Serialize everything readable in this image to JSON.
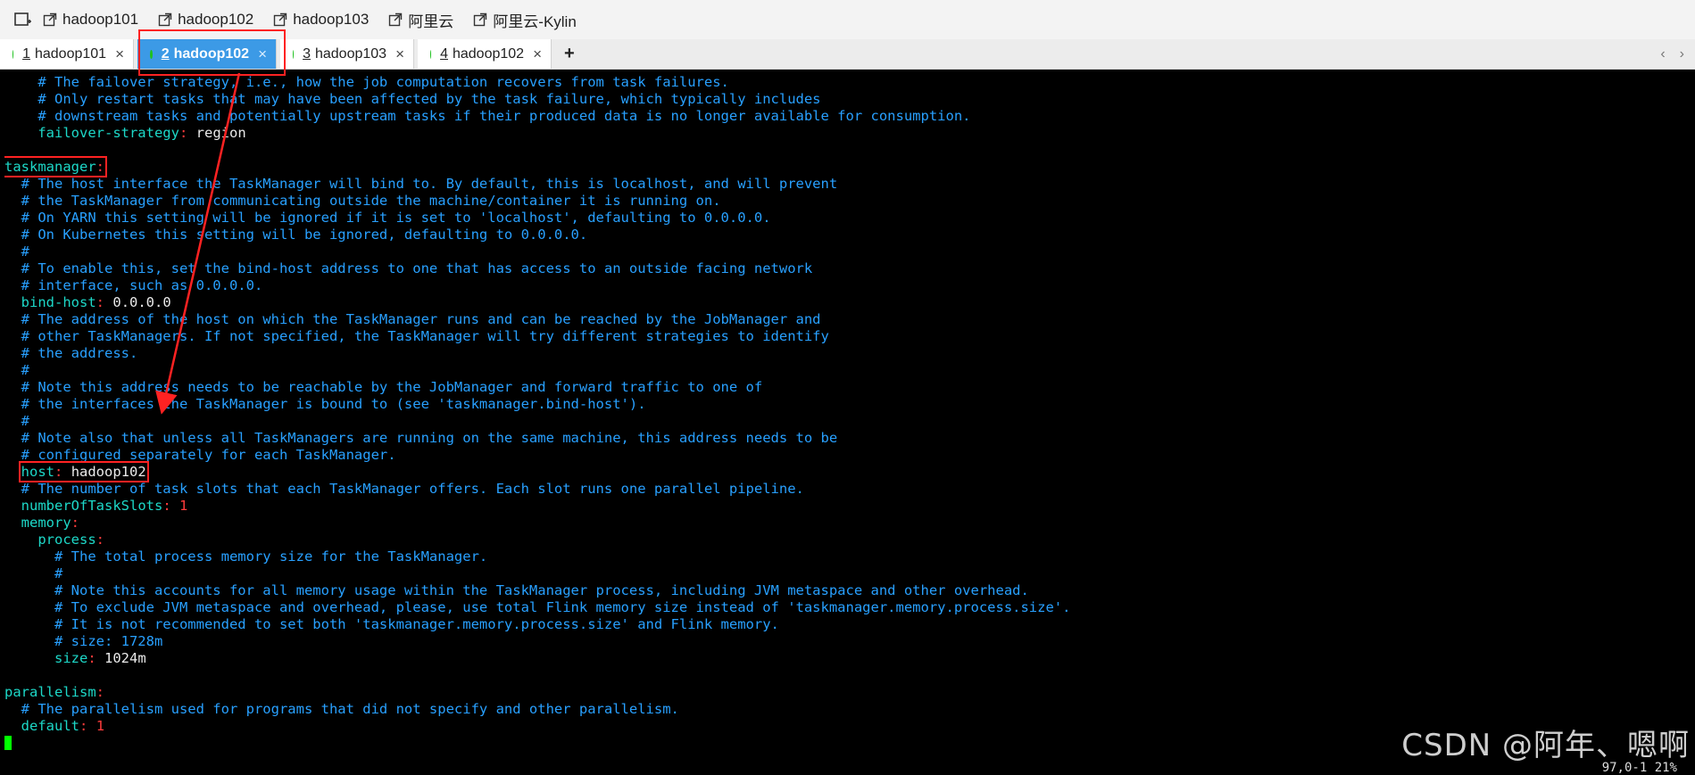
{
  "bookmarks": {
    "items": [
      {
        "label": "hadoop101"
      },
      {
        "label": "hadoop102"
      },
      {
        "label": "hadoop103"
      },
      {
        "label": "阿里云"
      },
      {
        "label": "阿里云-Kylin"
      }
    ]
  },
  "tabs": [
    {
      "num": "1",
      "label": "hadoop101",
      "close": "×",
      "active": false
    },
    {
      "num": "2",
      "label": "hadoop102",
      "close": "×",
      "active": true
    },
    {
      "num": "3",
      "label": "hadoop103",
      "close": "×",
      "active": false
    },
    {
      "num": "4",
      "label": "hadoop102",
      "close": "×",
      "active": false
    }
  ],
  "tab_add": "+",
  "tab_nav": {
    "prev": "‹",
    "next": "›"
  },
  "terminal": {
    "lines": [
      {
        "t": "c",
        "text": "    # The failover strategy, i.e., how the job computation recovers from task failures."
      },
      {
        "t": "c",
        "text": "    # Only restart tasks that may have been affected by the task failure, which typically includes"
      },
      {
        "t": "c",
        "text": "    # downstream tasks and potentially upstream tasks if their produced data is no longer available for consumption."
      },
      {
        "t": "kv",
        "indent": "    ",
        "key": "failover-strategy",
        "value": "region"
      },
      {
        "t": "empty",
        "text": ""
      },
      {
        "t": "kv",
        "indent": "",
        "key": "taskmanager",
        "value": "",
        "hl": true
      },
      {
        "t": "c",
        "text": "  # The host interface the TaskManager will bind to. By default, this is localhost, and will prevent"
      },
      {
        "t": "c",
        "text": "  # the TaskManager from communicating outside the machine/container it is running on."
      },
      {
        "t": "c",
        "text": "  # On YARN this setting will be ignored if it is set to 'localhost', defaulting to 0.0.0.0."
      },
      {
        "t": "c",
        "text": "  # On Kubernetes this setting will be ignored, defaulting to 0.0.0.0."
      },
      {
        "t": "c",
        "text": "  #"
      },
      {
        "t": "c",
        "text": "  # To enable this, set the bind-host address to one that has access to an outside facing network"
      },
      {
        "t": "c",
        "text": "  # interface, such as 0.0.0.0."
      },
      {
        "t": "kv",
        "indent": "  ",
        "key": "bind-host",
        "value": "0.0.0.0"
      },
      {
        "t": "c",
        "text": "  # The address of the host on which the TaskManager runs and can be reached by the JobManager and"
      },
      {
        "t": "c",
        "text": "  # other TaskManagers. If not specified, the TaskManager will try different strategies to identify"
      },
      {
        "t": "c",
        "text": "  # the address."
      },
      {
        "t": "c",
        "text": "  #"
      },
      {
        "t": "c",
        "text": "  # Note this address needs to be reachable by the JobManager and forward traffic to one of"
      },
      {
        "t": "c",
        "text": "  # the interfaces the TaskManager is bound to (see 'taskmanager.bind-host')."
      },
      {
        "t": "c",
        "text": "  #"
      },
      {
        "t": "c",
        "text": "  # Note also that unless all TaskManagers are running on the same machine, this address needs to be"
      },
      {
        "t": "c",
        "text": "  # configured separately for each TaskManager."
      },
      {
        "t": "kv",
        "indent": "  ",
        "key": "host",
        "value": "hadoop102",
        "hl": true
      },
      {
        "t": "c",
        "text": "  # The number of task slots that each TaskManager offers. Each slot runs one parallel pipeline."
      },
      {
        "t": "kv",
        "indent": "  ",
        "key": "numberOfTaskSlots",
        "value": "1",
        "num": true
      },
      {
        "t": "kv",
        "indent": "  ",
        "key": "memory",
        "value": ""
      },
      {
        "t": "kv",
        "indent": "    ",
        "key": "process",
        "value": ""
      },
      {
        "t": "c",
        "text": "      # The total process memory size for the TaskManager."
      },
      {
        "t": "c",
        "text": "      #"
      },
      {
        "t": "c",
        "text": "      # Note this accounts for all memory usage within the TaskManager process, including JVM metaspace and other overhead."
      },
      {
        "t": "c",
        "text": "      # To exclude JVM metaspace and overhead, please, use total Flink memory size instead of 'taskmanager.memory.process.size'."
      },
      {
        "t": "c",
        "text": "      # It is not recommended to set both 'taskmanager.memory.process.size' and Flink memory."
      },
      {
        "t": "c",
        "text": "      # size: 1728m"
      },
      {
        "t": "kv",
        "indent": "      ",
        "key": "size",
        "value": "1024m"
      },
      {
        "t": "empty",
        "text": ""
      },
      {
        "t": "kv",
        "indent": "",
        "key": "parallelism",
        "value": ""
      },
      {
        "t": "c",
        "text": "  # The parallelism used for programs that did not specify and other parallelism."
      },
      {
        "t": "kv",
        "indent": "  ",
        "key": "default",
        "value": "1",
        "num": true
      },
      {
        "t": "cursor",
        "text": ""
      }
    ]
  },
  "status": "97,0-1          21%",
  "watermark": "CSDN @阿年、嗯啊",
  "colors": {
    "comment": "#28a0ff",
    "key": "#1dd8c8",
    "number": "#ff3b3b",
    "highlight_box": "#ff2222",
    "active_tab": "#3c9ae6",
    "status_dot": "#1fc21f",
    "cursor": "#00ff00"
  },
  "icons": {
    "bookmark_toggle": "new-tab-icon",
    "bookmark_item": "external-link-icon",
    "tab_status": "green-dot-icon"
  }
}
